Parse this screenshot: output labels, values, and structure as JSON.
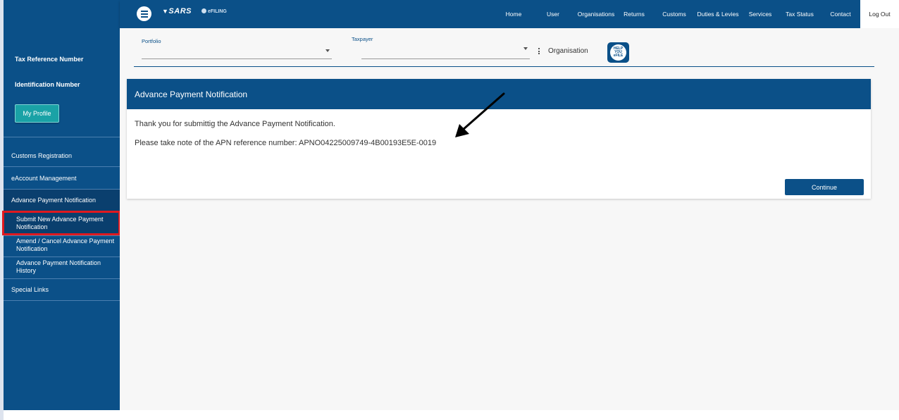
{
  "brand": {
    "logo_text": "SARS",
    "sub_text": "eFILING"
  },
  "nav": {
    "items": [
      "Home",
      "User",
      "Organisations",
      "Returns",
      "Customs",
      "Duties & Levies",
      "Services",
      "Tax Status",
      "Contact"
    ],
    "logout": "Log Out"
  },
  "sidebar": {
    "tax_ref_label": "Tax Reference Number",
    "id_label": "Identification Number",
    "profile_button": "My Profile",
    "items": {
      "customs_registration": "Customs Registration",
      "eaccount_management": "eAccount Management",
      "advance_payment_notification": "Advance Payment Notification",
      "special_links": "Special Links"
    },
    "subitems": {
      "submit_new": "Submit New Advance Payment Notification",
      "amend_cancel": "Amend / Cancel Advance Payment Notification",
      "history": "Advance Payment Notification History"
    }
  },
  "filters": {
    "portfolio_label": "Portfolio",
    "portfolio_value": "",
    "taxpayer_label": "Taxpayer",
    "taxpayer_value": "",
    "organisation_label": "Organisation",
    "help_icon_text": "HELP YOU eFILE"
  },
  "card": {
    "title": "Advance Payment Notification",
    "message1": "Thank you for submittig the Advance Payment Notification.",
    "message2": "Please take note of the APN reference number: APNO04225009749-4B00193E5E-0019",
    "continue_button": "Continue"
  },
  "colors": {
    "primary": "#0b5088",
    "highlight": "#e0191f",
    "profile_button": "#1aa2a6"
  }
}
